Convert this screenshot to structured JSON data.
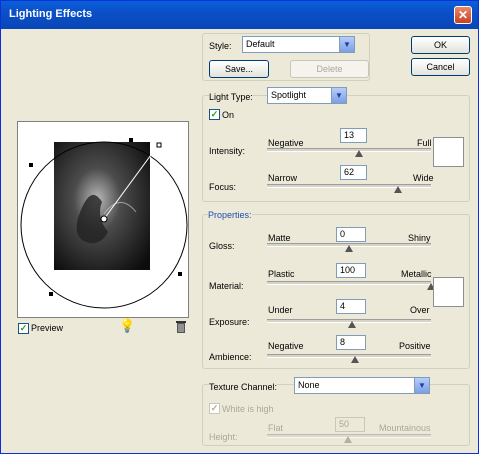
{
  "window": {
    "title": "Lighting Effects"
  },
  "style": {
    "label": "Style:",
    "value": "Default",
    "save": "Save...",
    "delete": "Delete"
  },
  "actions": {
    "ok": "OK",
    "cancel": "Cancel"
  },
  "light": {
    "type_label": "Light Type:",
    "type_value": "Spotlight",
    "on_label": "On",
    "on_checked": true,
    "intensity": {
      "label": "Intensity:",
      "min": "Negative",
      "max": "Full",
      "value": "13"
    },
    "focus": {
      "label": "Focus:",
      "min": "Narrow",
      "max": "Wide",
      "value": "62"
    }
  },
  "properties": {
    "title": "Properties:",
    "gloss": {
      "label": "Gloss:",
      "min": "Matte",
      "max": "Shiny",
      "value": "0"
    },
    "material": {
      "label": "Material:",
      "min": "Plastic",
      "max": "Metallic",
      "value": "100"
    },
    "exposure": {
      "label": "Exposure:",
      "min": "Under",
      "max": "Over",
      "value": "4"
    },
    "ambience": {
      "label": "Ambience:",
      "min": "Negative",
      "max": "Positive",
      "value": "8"
    }
  },
  "texture": {
    "channel_label": "Texture Channel:",
    "channel_value": "None",
    "white_high_label": "White is high",
    "white_high_checked": true,
    "height_label": "Height:",
    "height_min": "Flat",
    "height_max": "Mountainous",
    "height_value": "50"
  },
  "preview": {
    "label": "Preview",
    "checked": true
  },
  "icons": [
    "light-bulb-icon",
    "trash-icon"
  ]
}
